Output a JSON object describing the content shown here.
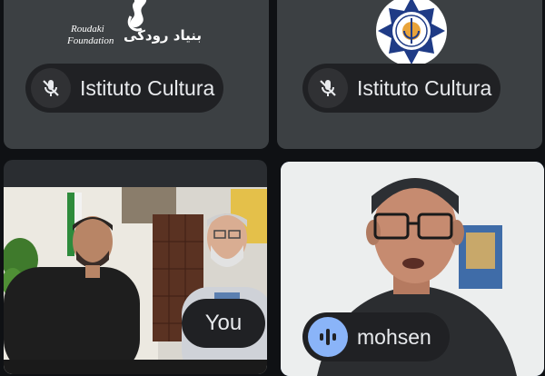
{
  "participants": [
    {
      "name": "Istituto Cultura",
      "muted": true,
      "tile_content": "roudaki-foundation-logo"
    },
    {
      "name": "Istituto Cultura",
      "muted": true,
      "tile_content": "star-seal-logo"
    },
    {
      "name": "You",
      "muted": false,
      "tile_content": "camera-video"
    },
    {
      "name": "mohsen",
      "muted": false,
      "speaking": true,
      "tile_content": "camera-video"
    }
  ],
  "logo": {
    "roudaki_latin_line1": "Roudaki",
    "roudaki_latin_line2": "Foundation",
    "roudaki_persian": "بنیاد رودکی"
  },
  "colors": {
    "tile_bg": "#3c4043",
    "chip_bg": "#202124",
    "active_speaker_border": "#8ab4f8"
  }
}
